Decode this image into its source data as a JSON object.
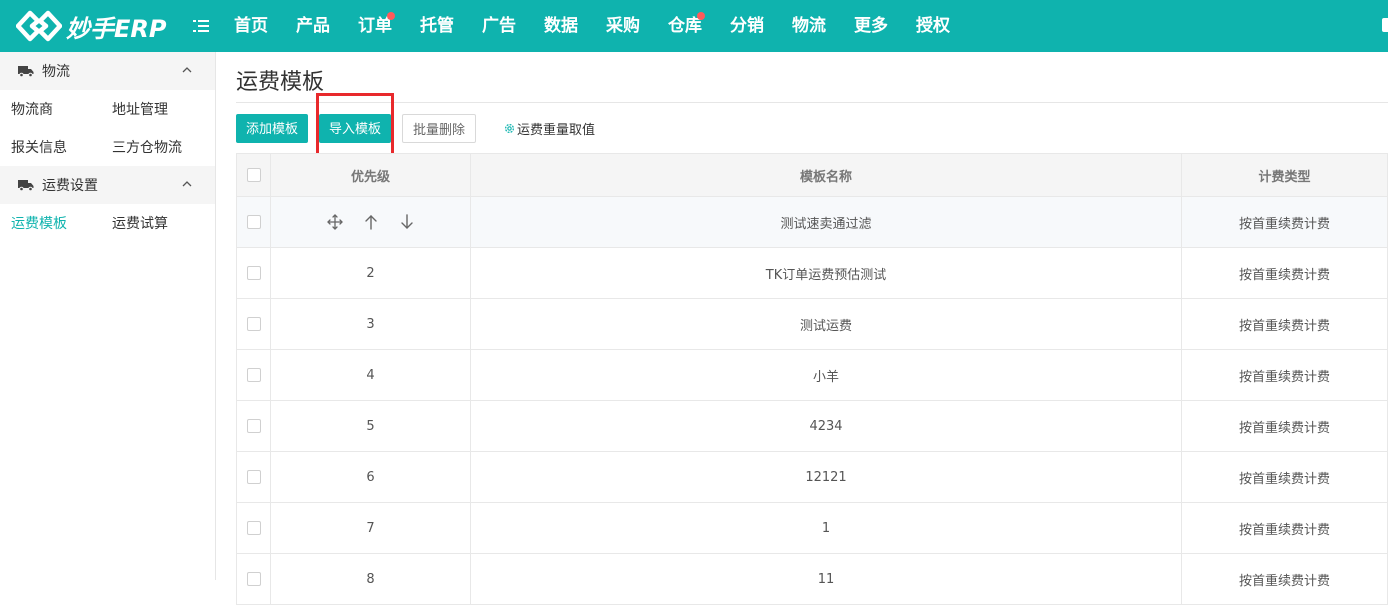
{
  "app": {
    "logo_text": "妙手ERP"
  },
  "nav": {
    "items": [
      {
        "label": "首页",
        "dot": false
      },
      {
        "label": "产品",
        "dot": false
      },
      {
        "label": "订单",
        "dot": true
      },
      {
        "label": "托管",
        "dot": false
      },
      {
        "label": "广告",
        "dot": false
      },
      {
        "label": "数据",
        "dot": false
      },
      {
        "label": "采购",
        "dot": false
      },
      {
        "label": "仓库",
        "dot": true
      },
      {
        "label": "分销",
        "dot": false
      },
      {
        "label": "物流",
        "dot": false
      },
      {
        "label": "更多",
        "dot": false
      },
      {
        "label": "授权",
        "dot": false
      }
    ]
  },
  "sidebar": {
    "group1": {
      "label": "物流",
      "items": [
        "物流商",
        "地址管理",
        "报关信息",
        "三方仓物流"
      ]
    },
    "group2": {
      "label": "运费设置",
      "items": [
        "运费模板",
        "运费试算"
      ]
    }
  },
  "page": {
    "title": "运费模板"
  },
  "toolbar": {
    "add_label": "添加模板",
    "import_label": "导入模板",
    "batch_delete_label": "批量删除",
    "weight_setting_label": "运费重量取值"
  },
  "table": {
    "headers": {
      "priority": "优先级",
      "name": "模板名称",
      "type": "计费类型"
    },
    "rows": [
      {
        "priority": "",
        "name": "测试速卖通过滤",
        "type": "按首重续费计费"
      },
      {
        "priority": "2",
        "name": "TK订单运费预估测试",
        "type": "按首重续费计费"
      },
      {
        "priority": "3",
        "name": "测试运费",
        "type": "按首重续费计费"
      },
      {
        "priority": "4",
        "name": "小羊",
        "type": "按首重续费计费"
      },
      {
        "priority": "5",
        "name": "4234",
        "type": "按首重续费计费"
      },
      {
        "priority": "6",
        "name": "12121",
        "type": "按首重续费计费"
      },
      {
        "priority": "7",
        "name": "1",
        "type": "按首重续费计费"
      },
      {
        "priority": "8",
        "name": "11",
        "type": "按首重续费计费"
      }
    ]
  },
  "colors": {
    "accent": "#0fb3ae",
    "highlight_box": "#e8292c",
    "notify_dot": "#ff5a5a"
  }
}
